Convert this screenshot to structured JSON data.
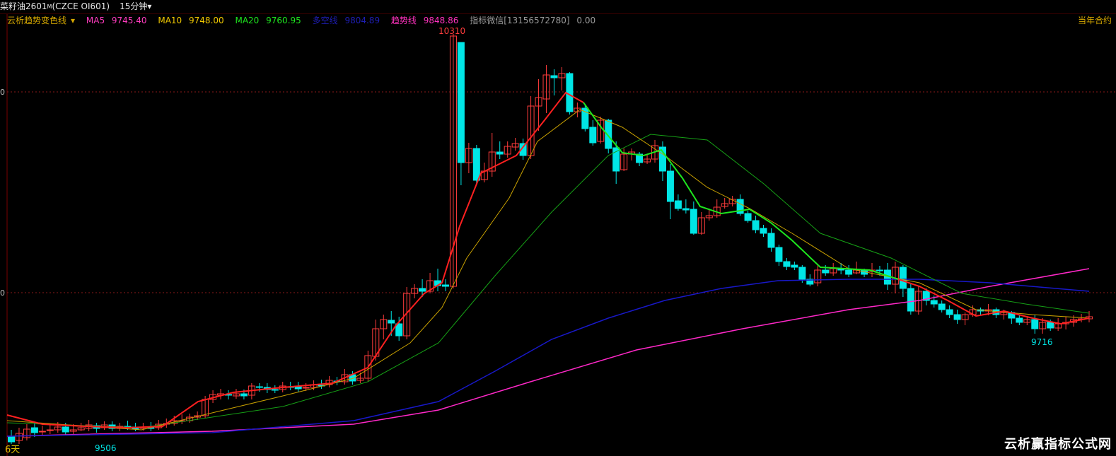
{
  "header": {
    "symbol_name": "菜籽油2601",
    "symbol_suffix": "M",
    "symbol_code": "(CZCE  OI601)",
    "period": "15分钟",
    "period_arrow": "▾"
  },
  "legend": {
    "indicator_name": "云析趋势变色线",
    "indicator_arrow": "▾",
    "items": [
      {
        "label": "MA5",
        "value": "9745.40",
        "color": "#ff3cbe"
      },
      {
        "label": "MA10",
        "value": "9748.00",
        "color": "#f0c800"
      },
      {
        "label": "MA20",
        "value": "9760.95",
        "color": "#1ee61e"
      },
      {
        "label": "多空线",
        "value": "9804.89",
        "color": "#1e1eb4"
      },
      {
        "label": "趋势线",
        "value": "9848.86",
        "color": "#ff32be"
      },
      {
        "label": "指标微信[13156572780]",
        "value": "0.00",
        "color": "#9a9a9a"
      }
    ]
  },
  "right_label": "当年合约",
  "bottom_label": "6天",
  "watermark": "云析赢指标公式网",
  "chart_data": {
    "type": "candlestick",
    "high_label": "10310",
    "low_label": "9506",
    "end_low_label": "9716",
    "y_axis": {
      "labels": [
        "0",
        "0"
      ]
    },
    "colors": {
      "up": "#ff3c3c",
      "down": "#00e6e6",
      "ma_trend": "#ff2020",
      "ma_trend_alt": "#1ee61e",
      "ma10": "#c8a000",
      "ma20": "#16a016",
      "long_short": "#1818c8",
      "trend": "#ff28c8"
    }
  }
}
